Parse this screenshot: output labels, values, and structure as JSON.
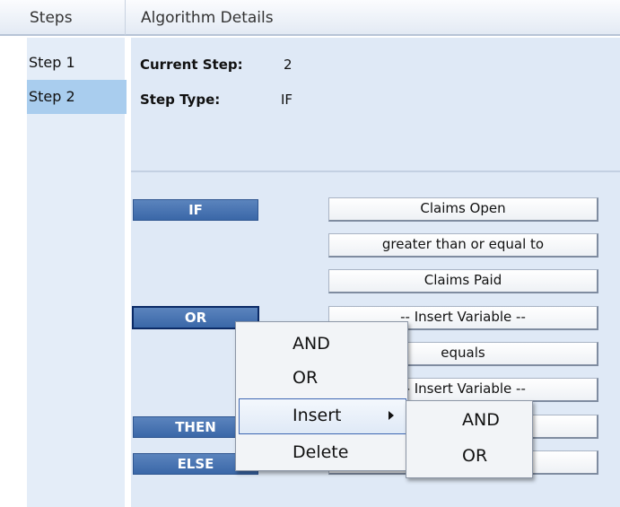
{
  "headers": {
    "steps": "Steps",
    "details": "Algorithm Details"
  },
  "sidebar": {
    "items": [
      {
        "label": "Step 1",
        "selected": false
      },
      {
        "label": "Step 2",
        "selected": true
      }
    ]
  },
  "details": {
    "current_step_label": "Current Step:",
    "current_step_value": "2",
    "step_type_label": "Step Type:",
    "step_type_value": "IF"
  },
  "logic": {
    "if_label": "IF",
    "or_label": "OR",
    "then_label": "THEN",
    "else_label": "ELSE",
    "condition1": [
      "Claims  Open",
      "greater than or equal to",
      "Claims  Paid"
    ],
    "condition2": [
      "-- Insert Variable --",
      "equals",
      "-- Insert Variable --"
    ]
  },
  "context_menu": {
    "items": [
      "AND",
      "OR",
      "Insert",
      "Delete"
    ],
    "highlighted": "Insert"
  },
  "submenu": {
    "items": [
      "AND",
      "OR"
    ]
  },
  "colors": {
    "keyword_blue": "#3a67a8",
    "selected_step": "#a9cdee",
    "panel_bg": "#dfe9f6"
  }
}
